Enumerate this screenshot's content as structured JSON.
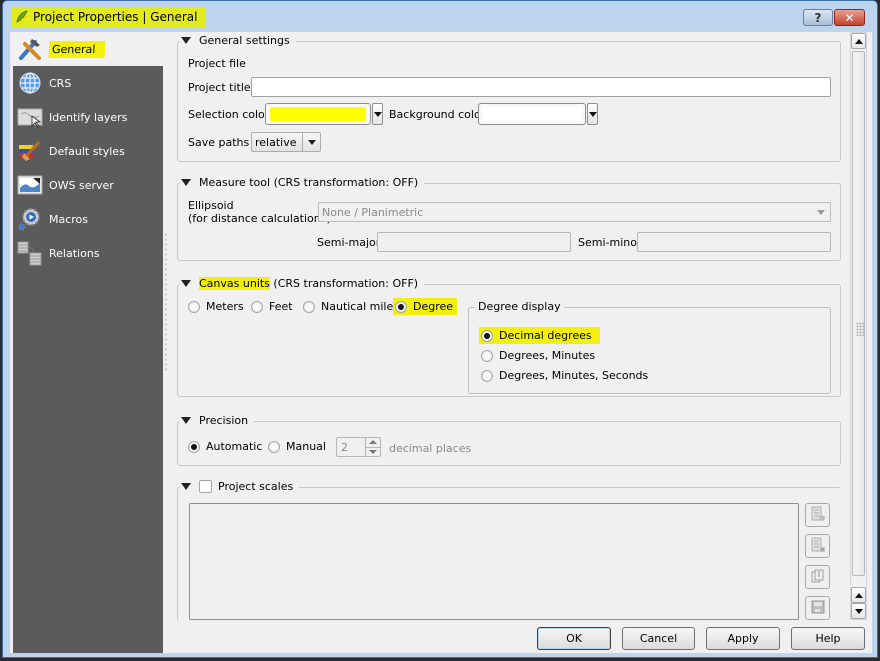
{
  "window": {
    "title": "Project Properties | General",
    "help_button": "?",
    "close_button": "✕"
  },
  "sidebar": {
    "items": [
      {
        "label": "General",
        "icon": "hammer-wrench-icon",
        "active": true
      },
      {
        "label": "CRS",
        "icon": "globe-icon"
      },
      {
        "label": "Identify layers",
        "icon": "identify-map-icon"
      },
      {
        "label": "Default styles",
        "icon": "paintbrush-icon"
      },
      {
        "label": "OWS server",
        "icon": "ows-map-icon"
      },
      {
        "label": "Macros",
        "icon": "gear-play-icon"
      },
      {
        "label": "Relations",
        "icon": "table-relations-icon"
      }
    ]
  },
  "general_settings": {
    "title": "General settings",
    "project_file_label": "Project file",
    "project_title_label": "Project title",
    "project_title_value": "",
    "selection_color_label": "Selection color",
    "selection_color": "#ffff00",
    "background_color_label": "Background color",
    "background_color": "#ffffff",
    "save_paths_label": "Save paths",
    "save_paths_value": "relative"
  },
  "measure_tool": {
    "title": "Measure tool (CRS transformation: OFF)",
    "ellipsoid_label_1": "Ellipsoid",
    "ellipsoid_label_2": "(for distance calculations)",
    "ellipsoid_value": "None / Planimetric",
    "semi_major_label": "Semi-major",
    "semi_major_value": "",
    "semi_minor_label": "Semi-minor",
    "semi_minor_value": ""
  },
  "canvas_units": {
    "title_highlight": "Canvas units",
    "title_rest": " (CRS transformation: OFF)",
    "options": [
      {
        "label": "Meters",
        "checked": false
      },
      {
        "label": "Feet",
        "checked": false
      },
      {
        "label": "Nautical miles",
        "checked": false
      },
      {
        "label": "Degree",
        "checked": true
      }
    ],
    "degree_display": {
      "title": "Degree display",
      "options": [
        {
          "label": "Decimal degrees",
          "checked": true
        },
        {
          "label": "Degrees, Minutes",
          "checked": false
        },
        {
          "label": "Degrees, Minutes, Seconds",
          "checked": false
        }
      ]
    }
  },
  "precision": {
    "title": "Precision",
    "automatic_label": "Automatic",
    "automatic_checked": true,
    "manual_label": "Manual",
    "manual_checked": false,
    "decimal_value": "2",
    "decimal_places_label": "decimal places"
  },
  "project_scales": {
    "title": "Project scales",
    "checked": false,
    "tool_buttons": [
      "add-scale-icon",
      "remove-scale-icon",
      "import-scales-icon",
      "save-scales-icon"
    ]
  },
  "buttons": {
    "ok": "OK",
    "cancel": "Cancel",
    "apply": "Apply",
    "help": "Help"
  },
  "colors": {
    "highlight": "#f2f00c",
    "sidebar_bg": "#5b5b5b",
    "window_frame": "#bcd4ee"
  }
}
